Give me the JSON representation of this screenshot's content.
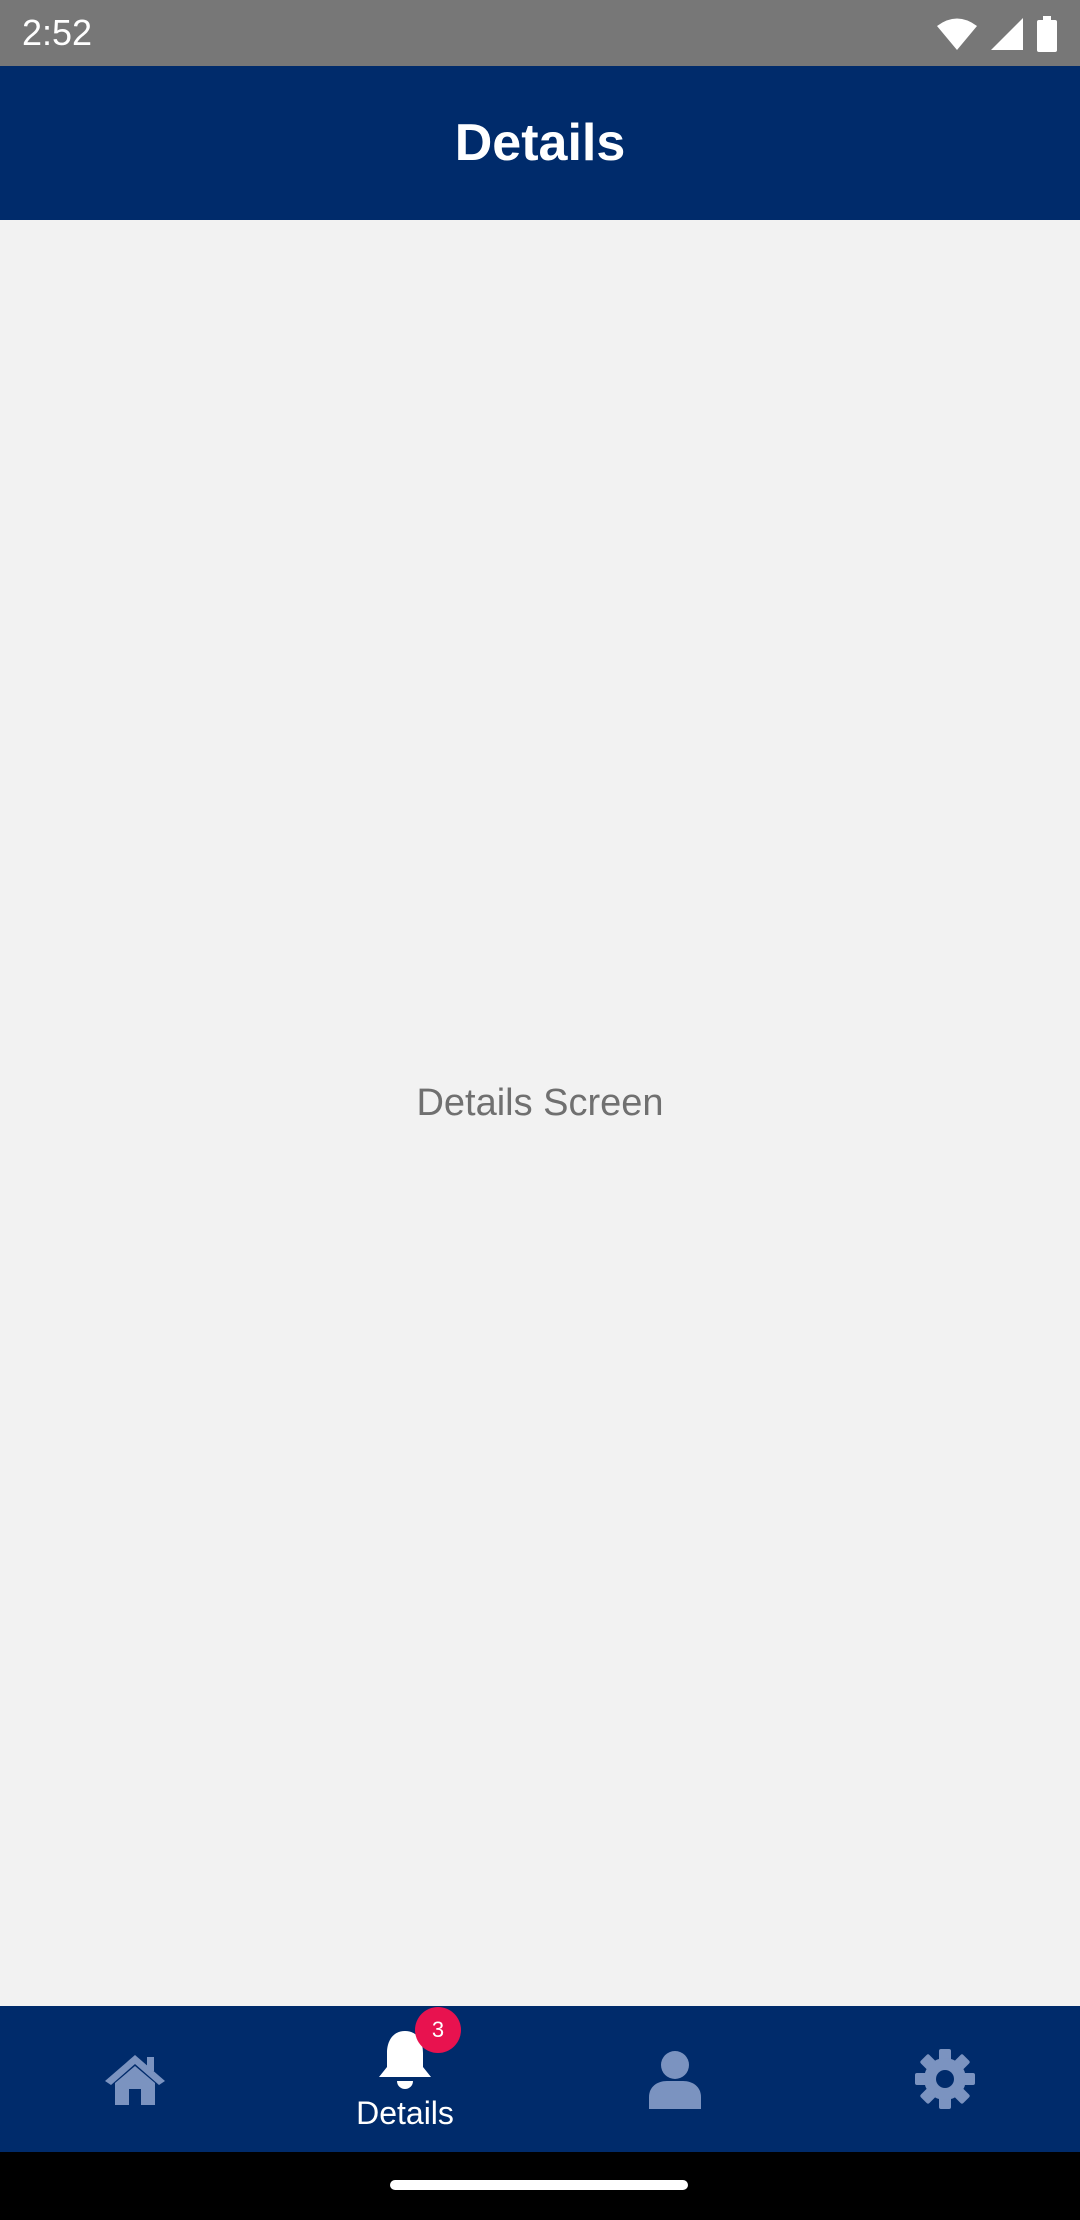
{
  "status_bar": {
    "time": "2:52",
    "icons": [
      "wifi-icon",
      "cell-signal-icon",
      "battery-icon"
    ]
  },
  "header": {
    "title": "Details"
  },
  "content": {
    "message": "Details Screen"
  },
  "bottom_nav": {
    "items": [
      {
        "icon": "home-icon",
        "label": "",
        "active": false
      },
      {
        "icon": "bell-icon",
        "label": "Details",
        "active": true,
        "badge": "3"
      },
      {
        "icon": "profile-icon",
        "label": "",
        "active": false
      },
      {
        "icon": "settings-icon",
        "label": "",
        "active": false
      }
    ]
  },
  "colors": {
    "primary": "#002b6b",
    "background": "#f2f2f2",
    "badge": "#e8124f",
    "inactive_icon": "#7b93c0",
    "active_icon": "#ffffff"
  }
}
